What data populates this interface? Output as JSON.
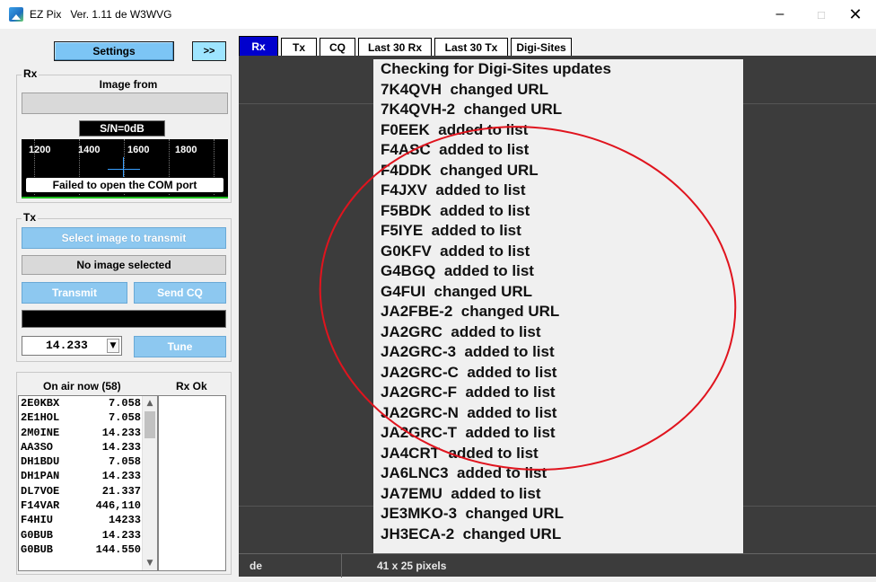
{
  "window": {
    "title": "EZ Pix   Ver. 1.11 de W3WVG",
    "minimize": "–",
    "maximize": "□",
    "close": "✕"
  },
  "left": {
    "settings_label": "Settings",
    "expand_label": ">>",
    "rx": {
      "group_label": "Rx",
      "image_from": "Image from",
      "sn": "S/N=0dB",
      "spectrum_ticks": [
        "1200",
        "1400",
        "1600",
        "1800"
      ],
      "com_error": "Failed to open the COM port"
    },
    "tx": {
      "group_label": "Tx",
      "select_image": "Select image to transmit",
      "no_image": "No image selected",
      "transmit": "Transmit",
      "send_cq": "Send CQ",
      "frequency": "14.233",
      "tune": "Tune"
    },
    "on_air": {
      "header": "On air now (58)",
      "rx_ok_header": "Rx Ok",
      "stations": [
        {
          "call": "2E0KBX",
          "freq": "7.058"
        },
        {
          "call": "2E1HOL",
          "freq": "7.058"
        },
        {
          "call": "2M0INE",
          "freq": "14.233"
        },
        {
          "call": "AA3SO",
          "freq": "14.233"
        },
        {
          "call": "DH1BDU",
          "freq": "7.058"
        },
        {
          "call": "DH1PAN",
          "freq": "14.233"
        },
        {
          "call": "DL7VOE",
          "freq": "21.337"
        },
        {
          "call": "F14VAR",
          "freq": "446,110"
        },
        {
          "call": "F4HIU",
          "freq": "14233"
        },
        {
          "call": "G0BUB",
          "freq": "14.233"
        },
        {
          "call": "G0BUB",
          "freq": "144.550"
        }
      ]
    }
  },
  "tabs": [
    {
      "label": "Rx",
      "active": true
    },
    {
      "label": "Tx",
      "active": false
    },
    {
      "label": "CQ",
      "active": false
    },
    {
      "label": "Last 30 Rx",
      "active": false
    },
    {
      "label": "Last 30 Tx",
      "active": false
    },
    {
      "label": "Digi-Sites",
      "active": false
    }
  ],
  "messages": [
    "Checking for Digi-Sites updates",
    "7K4QVH  changed URL",
    "7K4QVH-2  changed URL",
    "F0EEK  added to list",
    "F4ASC  added to list",
    "F4DDK  changed URL",
    "F4JXV  added to list",
    "F5BDK  added to list",
    "F5IYE  added to list",
    "G0KFV  added to list",
    "G4BGQ  added to list",
    "G4FUI  changed URL",
    "JA2FBE-2  changed URL",
    "JA2GRC  added to list",
    "JA2GRC-3  added to list",
    "JA2GRC-C  added to list",
    "JA2GRC-F  added to list",
    "JA2GRC-N  added to list",
    "JA2GRC-T  added to list",
    "JA4CRT  added to list",
    "JA6LNC3  added to list",
    "JA7EMU  added to list",
    "JE3MKO-3  changed URL",
    "JH3ECA-2  changed URL"
  ],
  "status": {
    "left": "de",
    "image_size": "41 x 25 pixels"
  },
  "colors": {
    "accent_blue": "#0000cd",
    "button_blue": "#7cc5f5",
    "annotation_red": "#e0141e"
  }
}
